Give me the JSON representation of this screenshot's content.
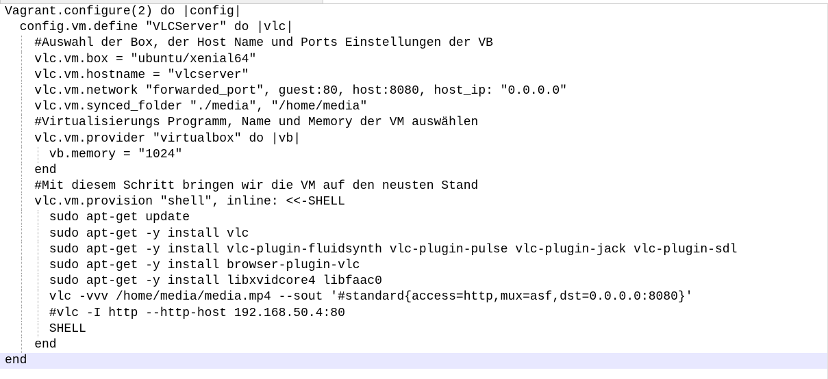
{
  "editor": {
    "current_line_color": "#e8e8ff",
    "lines": [
      "Vagrant.configure(2) do |config|",
      "  config.vm.define \"VLCServer\" do |vlc|",
      "    #Auswahl der Box, der Host Name und Ports Einstellungen der VB",
      "    vlc.vm.box = \"ubuntu/xenial64\"",
      "    vlc.vm.hostname = \"vlcserver\"",
      "    vlc.vm.network \"forwarded_port\", guest:80, host:8080, host_ip: \"0.0.0.0\"",
      "    vlc.vm.synced_folder \"./media\", \"/home/media\"",
      "    #Virtualisierungs Programm, Name und Memory der VM auswählen",
      "    vlc.vm.provider \"virtualbox\" do |vb|",
      "      vb.memory = \"1024\"",
      "    end",
      "    #Mit diesem Schritt bringen wir die VM auf den neusten Stand",
      "    vlc.vm.provision \"shell\", inline: <<-SHELL",
      "      sudo apt-get update",
      "      sudo apt-get -y install vlc",
      "      sudo apt-get -y install vlc-plugin-fluidsynth vlc-plugin-pulse vlc-plugin-jack vlc-plugin-sdl",
      "      sudo apt-get -y install browser-plugin-vlc",
      "      sudo apt-get -y install libxvidcore4 libfaac0",
      "      vlc -vvv /home/media/media.mp4 --sout '#standard{access=http,mux=asf,dst=0.0.0.0:8080}'",
      "      #vlc -I http --http-host 192.168.50.4:80",
      "      SHELL",
      "    end",
      "end"
    ]
  }
}
